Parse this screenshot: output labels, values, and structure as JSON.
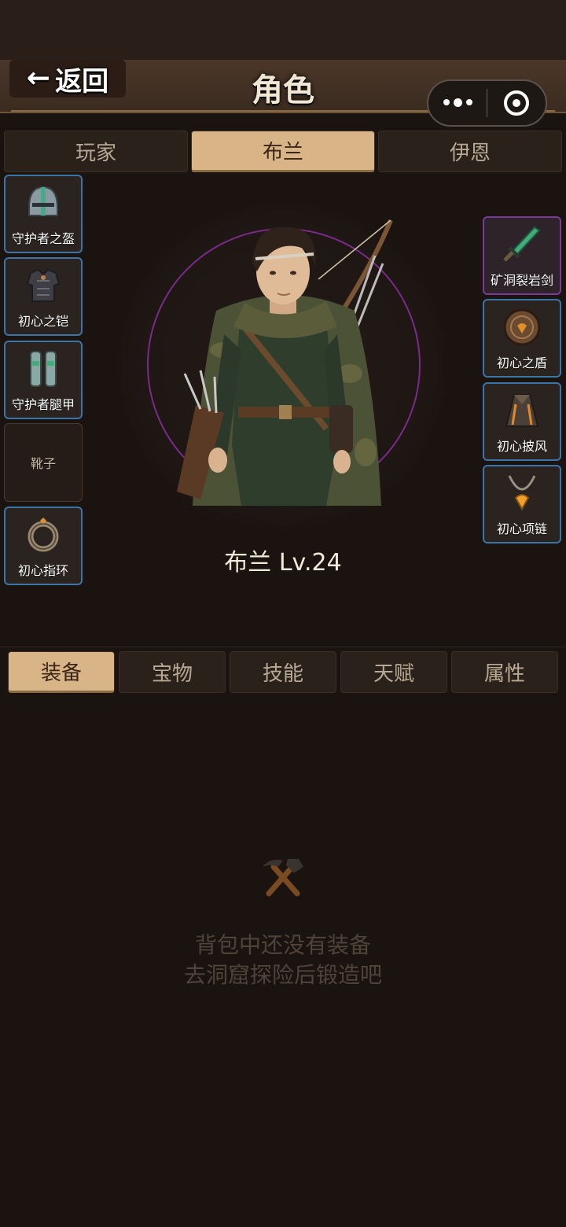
{
  "header": {
    "back_label": "返回",
    "title": "角色"
  },
  "character_tabs": [
    {
      "label": "玩家",
      "active": false
    },
    {
      "label": "布兰",
      "active": true
    },
    {
      "label": "伊恩",
      "active": false
    }
  ],
  "left_slots": [
    {
      "label": "守护者之盔",
      "icon": "helmet-icon",
      "equipped": true
    },
    {
      "label": "初心之铠",
      "icon": "armor-icon",
      "equipped": true
    },
    {
      "label": "守护者腿甲",
      "icon": "greaves-icon",
      "equipped": true
    },
    {
      "label": "靴子",
      "icon": "",
      "equipped": false
    },
    {
      "label": "初心指环",
      "icon": "ring-icon",
      "equipped": true
    }
  ],
  "right_slots": [
    {
      "label": "矿洞裂岩剑",
      "icon": "sword-icon",
      "equipped": true,
      "rarity": "epic"
    },
    {
      "label": "初心之盾",
      "icon": "shield-icon",
      "equipped": true
    },
    {
      "label": "初心披风",
      "icon": "cloak-icon",
      "equipped": true
    },
    {
      "label": "初心项链",
      "icon": "necklace-icon",
      "equipped": true
    }
  ],
  "character": {
    "name_level": "布兰  Lv.24"
  },
  "sub_tabs": [
    {
      "label": "装备",
      "active": true
    },
    {
      "label": "宝物",
      "active": false
    },
    {
      "label": "技能",
      "active": false
    },
    {
      "label": "天赋",
      "active": false
    },
    {
      "label": "属性",
      "active": false
    }
  ],
  "empty_state": {
    "icon": "hammer-pickaxe-icon",
    "line1": "背包中还没有装备",
    "line2": "去洞窟探险后锻造吧"
  },
  "colors": {
    "background": "#1a1310",
    "active_tab": "#d9b486",
    "slot_border": "#3c74a8",
    "epic_border": "#7a3a9a"
  }
}
